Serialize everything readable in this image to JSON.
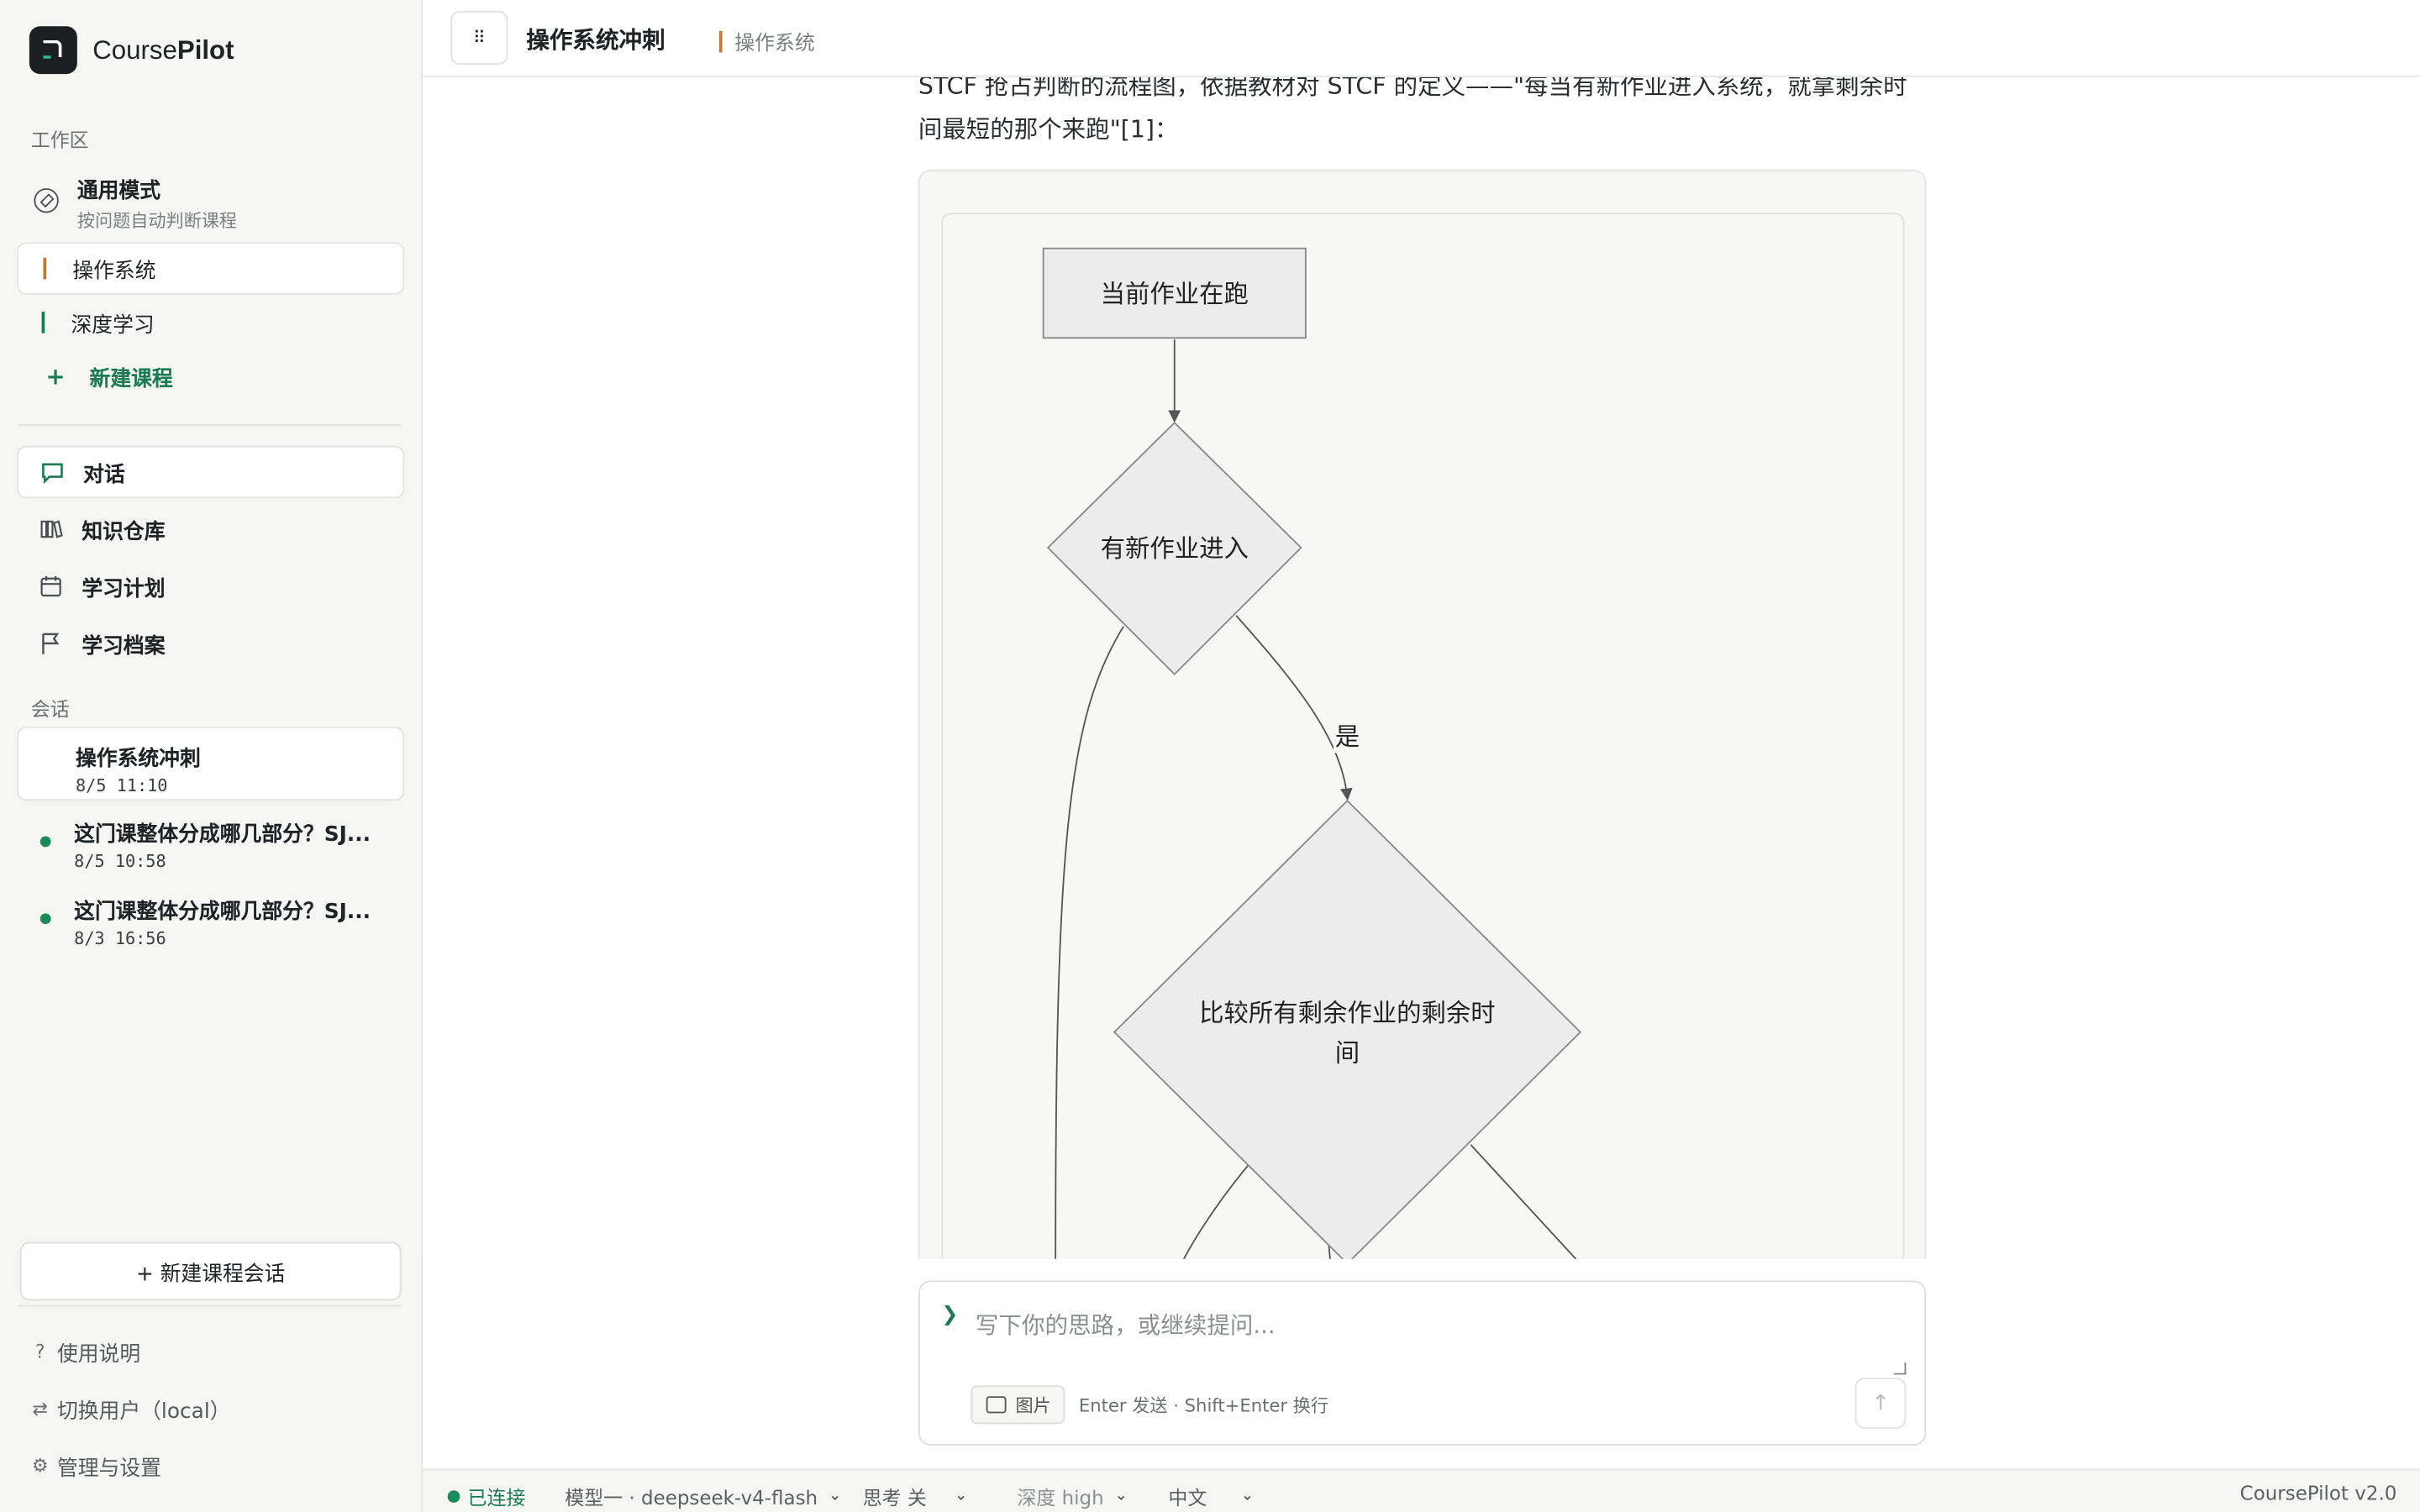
{
  "brand": {
    "name_prefix": "Course",
    "name_suffix": "Pilot"
  },
  "sidebar": {
    "workspace_label": "工作区",
    "mode": {
      "title": "通用模式",
      "subtitle": "按问题自动判断课程"
    },
    "courses": [
      {
        "label": "操作系统",
        "color": "#c0773a"
      },
      {
        "label": "深度学习",
        "color": "#1c7a52"
      }
    ],
    "new_course": "新建课程",
    "nav": [
      {
        "label": "对话",
        "icon": "chat-icon"
      },
      {
        "label": "知识仓库",
        "icon": "library-icon"
      },
      {
        "label": "学习计划",
        "icon": "calendar-icon"
      },
      {
        "label": "学习档案",
        "icon": "flag-icon"
      }
    ],
    "sessions_label": "会话",
    "sessions": [
      {
        "title": "操作系统冲刺",
        "date": "8/5 11:10"
      },
      {
        "title": "这门课整体分成哪几部分？SJ...",
        "date": "8/5 10:58"
      },
      {
        "title": "这门课整体分成哪几部分？SJ...",
        "date": "8/3 16:56"
      }
    ],
    "new_session": "+ 新建课程会话",
    "footer": [
      {
        "icon": "?",
        "label": "使用说明"
      },
      {
        "icon": "⇄",
        "label": "切换用户（local）"
      },
      {
        "icon": "⚙",
        "label": "管理与设置"
      }
    ]
  },
  "header": {
    "menu_icon": "⠿",
    "title": "操作系统冲刺",
    "course": "操作系统"
  },
  "content": {
    "paragraph": "STCF 抢占判断的流程图，依据教材对 STCF 的定义——\"每当有新作业进入系统，就拿剩余时间最短的那个来跑\"[1]：",
    "flow": {
      "n1": "当前作业在跑",
      "n2": "有新作业进入",
      "edge_yes": "是",
      "n3_line1": "比较所有剩余作业的剩余时",
      "n3_line2": "间"
    }
  },
  "composer": {
    "placeholder": "写下你的思路，或继续提问...",
    "image_button": "图片",
    "hint": "Enter 发送 · Shift+Enter 换行"
  },
  "status": {
    "connection": "已连接",
    "model": "模型一 · deepseek-v4-flash",
    "thinking": "思考 关",
    "depth": "深度 high",
    "language": "中文",
    "version": "CoursePilot v2.0"
  },
  "colors": {
    "accent": "#1c7a52",
    "course_os": "#c0773a"
  }
}
